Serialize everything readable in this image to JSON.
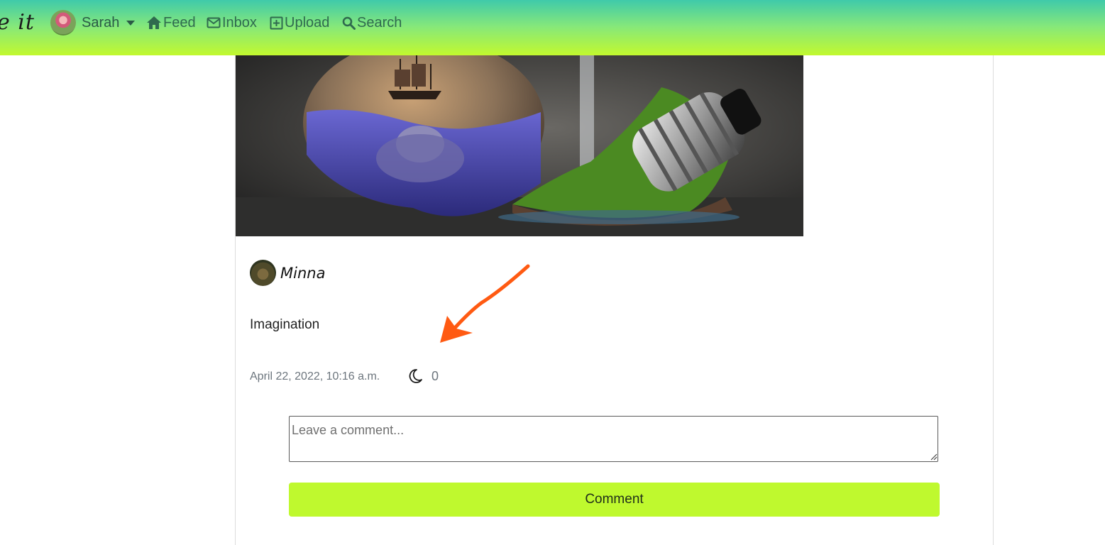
{
  "nav": {
    "brand_text": "e it",
    "user_name": "Sarah",
    "links": [
      {
        "label": "Feed",
        "icon": "home-icon"
      },
      {
        "label": "Inbox",
        "icon": "envelope-icon"
      },
      {
        "label": "Upload",
        "icon": "plus-square-icon"
      },
      {
        "label": "Search",
        "icon": "search-icon"
      }
    ]
  },
  "post": {
    "image_description_icon": "lightbulb-landscape-image",
    "author": "Minna",
    "caption": "Imagination",
    "timestamp": "April 22, 2022, 10:16 a.m.",
    "like_icon": "moon-icon",
    "like_count": "0"
  },
  "comment_form": {
    "placeholder": "Leave a comment...",
    "value": "",
    "button_label": "Comment"
  },
  "colors": {
    "nav_gradient_top": "#3fcaaa",
    "nav_gradient_bottom": "#c2f92e",
    "button_bg": "#bff92e",
    "annotation_arrow": "#ff5a12"
  }
}
